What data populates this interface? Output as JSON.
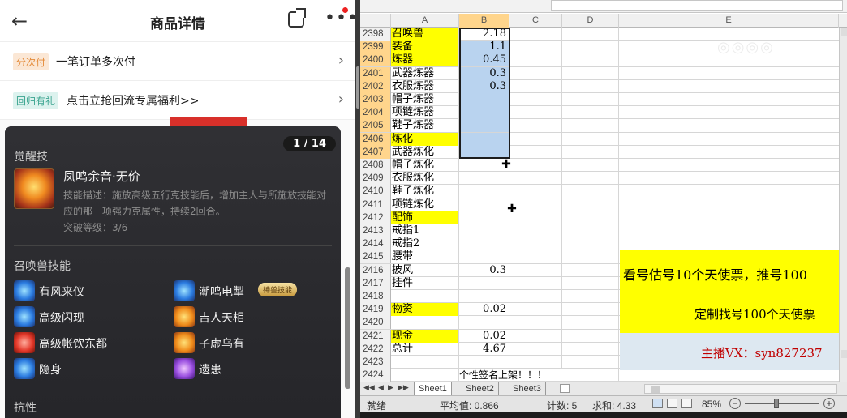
{
  "phone": {
    "header": {
      "back_icon": "←",
      "title": "商品详情"
    },
    "promos": [
      {
        "tag": "分次付",
        "text": "一笔订单多次付"
      },
      {
        "tag": "回归有礼",
        "text": "点击立抢回流专属福利>>"
      }
    ],
    "panel": {
      "pager": "1 / 14",
      "awaken_title": "觉醒技",
      "skill_name": "凤鸣余音·无价",
      "skill_desc": "技能描述：施放高级五行克技能后，增加主人与所施放技能对应的那一项强力克属性，持续2回合。",
      "skill_level": "突破等级：3/6",
      "summon_title": "召唤兽技能",
      "summon_skills": [
        {
          "name": "有风来仪",
          "color": "blue"
        },
        {
          "name": "潮鸣电掣",
          "color": "blue"
        },
        {
          "name": "高级闪现",
          "color": "blue"
        },
        {
          "name": "吉人天相",
          "color": "orange"
        },
        {
          "name": "高级帐饮东都",
          "color": "red"
        },
        {
          "name": "子虚乌有",
          "color": "orange"
        },
        {
          "name": "隐身",
          "color": "blue"
        },
        {
          "name": "遗患",
          "color": "purple"
        }
      ],
      "divine_tag": "神兽技能",
      "resist_title": "抗性"
    }
  },
  "excel": {
    "columns": [
      "A",
      "B",
      "C",
      "D",
      "E"
    ],
    "rows": [
      {
        "n": "2398",
        "a": "召唤兽",
        "b": "2.18",
        "ya": true,
        "sel": false
      },
      {
        "n": "2399",
        "a": "装备",
        "b": "1.1",
        "ya": true,
        "sel": true
      },
      {
        "n": "2400",
        "a": "炼器",
        "b": "0.45",
        "ya": true,
        "sel": true
      },
      {
        "n": "2401",
        "a": "武器炼器",
        "b": "0.3",
        "ya": false,
        "sel": true
      },
      {
        "n": "2402",
        "a": "衣服炼器",
        "b": "0.3",
        "ya": false,
        "sel": true
      },
      {
        "n": "2403",
        "a": "帽子炼器",
        "b": "",
        "ya": false,
        "sel": true
      },
      {
        "n": "2404",
        "a": "项链炼器",
        "b": "",
        "ya": false,
        "sel": true
      },
      {
        "n": "2405",
        "a": "鞋子炼器",
        "b": "",
        "ya": false,
        "sel": true
      },
      {
        "n": "2406",
        "a": "炼化",
        "b": "",
        "ya": true,
        "sel": true
      },
      {
        "n": "2407",
        "a": "武器炼化",
        "b": "",
        "ya": false,
        "sel": true
      },
      {
        "n": "2408",
        "a": "帽子炼化",
        "b": "",
        "ya": false,
        "sel": false
      },
      {
        "n": "2409",
        "a": "衣服炼化",
        "b": "",
        "ya": false,
        "sel": false
      },
      {
        "n": "2410",
        "a": "鞋子炼化",
        "b": "",
        "ya": false,
        "sel": false
      },
      {
        "n": "2411",
        "a": "项链炼化",
        "b": "",
        "ya": false,
        "sel": false
      },
      {
        "n": "2412",
        "a": "配饰",
        "b": "",
        "ya": true,
        "sel": false
      },
      {
        "n": "2413",
        "a": "戒指1",
        "b": "",
        "ya": false,
        "sel": false
      },
      {
        "n": "2414",
        "a": "戒指2",
        "b": "",
        "ya": false,
        "sel": false
      },
      {
        "n": "2415",
        "a": "腰带",
        "b": "",
        "ya": false,
        "sel": false
      },
      {
        "n": "2416",
        "a": "披风",
        "b": "0.3",
        "ya": false,
        "sel": false
      },
      {
        "n": "2417",
        "a": "挂件",
        "b": "",
        "ya": false,
        "sel": false
      },
      {
        "n": "2418",
        "a": "",
        "b": "",
        "ya": false,
        "sel": false
      },
      {
        "n": "2419",
        "a": "物资",
        "b": "0.02",
        "ya": true,
        "sel": false
      },
      {
        "n": "2420",
        "a": "",
        "b": "",
        "ya": false,
        "sel": false
      },
      {
        "n": "2421",
        "a": "现金",
        "b": "0.02",
        "ya": true,
        "sel": false
      },
      {
        "n": "2422",
        "a": "总计",
        "b": "4.67",
        "ya": false,
        "sel": false
      },
      {
        "n": "2423",
        "a": "",
        "b": "",
        "ya": false,
        "sel": false
      },
      {
        "n": "2424",
        "a": "",
        "b": "",
        "ya": false,
        "sel": false
      }
    ],
    "box1": "看号估号10个天使票，推号100",
    "box2": "定制找号100个天使票",
    "box3": "主播VX：syn827237",
    "banner": "个性签名上架！！！",
    "watermark": "◎◎◎◎",
    "sheets": [
      "Sheet1",
      "Sheet2",
      "Sheet3"
    ],
    "status": {
      "ready": "就绪",
      "avg": "平均值: 0.866",
      "count": "计数: 5",
      "sum": "求和: 4.33",
      "zoom": "85%"
    }
  },
  "colors": {
    "yellow": "#ffff00",
    "selection": "#b9d3ef",
    "accent_red": "#c00000"
  }
}
